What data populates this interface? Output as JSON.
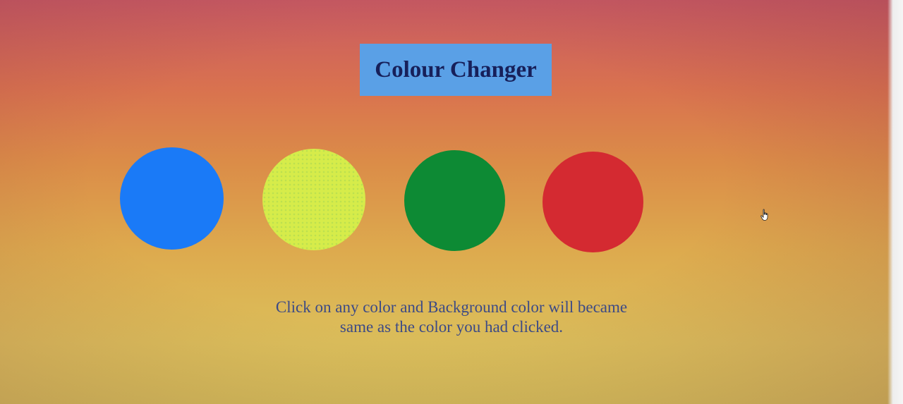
{
  "header": {
    "title": "Colour Changer"
  },
  "swatches": [
    {
      "name": "blue",
      "color": "#1a7af7"
    },
    {
      "name": "yellow",
      "color": "#d6ec4a"
    },
    {
      "name": "green",
      "color": "#0d8a34"
    },
    {
      "name": "red",
      "color": "#d42a31"
    }
  ],
  "instructions": {
    "line1": "Click on any color and Background color will became",
    "line2": "same as the color you had clicked."
  },
  "colors": {
    "title_bg": "#5aa0e6",
    "title_text": "#17205a",
    "instruction_text": "#3c4a86"
  },
  "icons": {
    "cursor": "hand-pointer-icon"
  }
}
